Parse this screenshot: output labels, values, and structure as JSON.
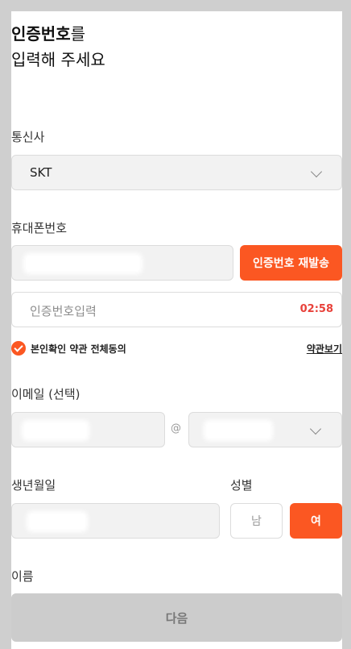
{
  "title": {
    "bold": "인증번호",
    "rest": "를",
    "line2": "입력해 주세요"
  },
  "carrier": {
    "label": "통신사",
    "value": "SKT"
  },
  "phone": {
    "label": "휴대폰번호",
    "resend_label": "인증번호 재발송"
  },
  "auth": {
    "placeholder": "인증번호입력",
    "timer": "02:58"
  },
  "terms": {
    "agree_label": "본인확인 약관 전체동의",
    "view_label": "약관보기"
  },
  "email": {
    "label": "이메일 (선택)",
    "at": "@"
  },
  "birth": {
    "label": "생년월일"
  },
  "gender": {
    "label": "성별",
    "male": "남",
    "female": "여"
  },
  "name": {
    "label": "이름"
  },
  "next": {
    "label": "다음"
  },
  "colors": {
    "accent": "#fb5722",
    "timer": "#e8413a",
    "disabled_button": "#cccccc"
  }
}
